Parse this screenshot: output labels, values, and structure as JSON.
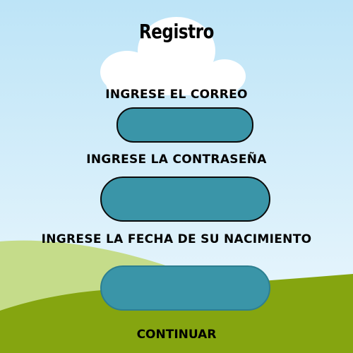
{
  "title": "Registro",
  "fields": [
    {
      "label": "INGRESE EL CORREO",
      "value": ""
    },
    {
      "label": "INGRESE LA CONTRASEÑA",
      "value": ""
    },
    {
      "label": "INGRESE LA FECHA DE SU NACIMIENTO",
      "value": ""
    }
  ],
  "continue_label": "CONTINUAR",
  "colors": {
    "sky_top": "#bde4f7",
    "sky_bottom": "#eaf6fc",
    "hill_light": "#c5dc8a",
    "hill_dark": "#85a510",
    "field_fill": "#3a95a8"
  }
}
